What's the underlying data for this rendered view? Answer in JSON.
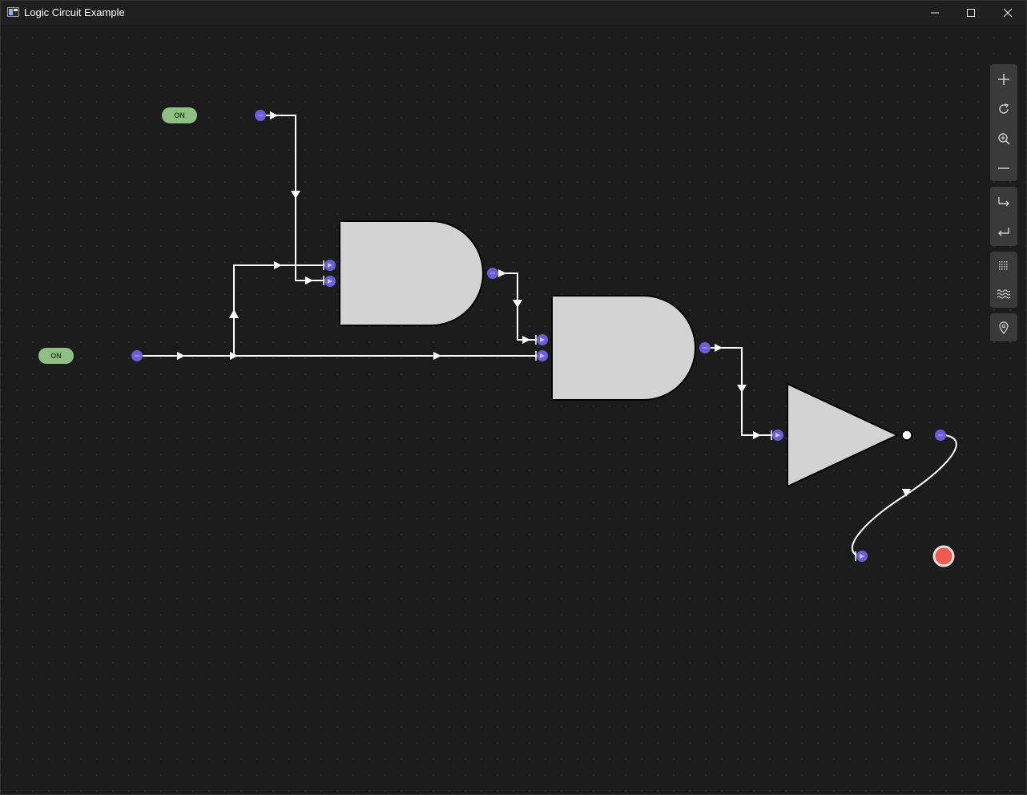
{
  "window": {
    "title": "Logic Circuit Example"
  },
  "nodes": {
    "toggle_top": {
      "label": "ON"
    },
    "toggle_left": {
      "label": "ON"
    }
  },
  "toolbar": {
    "groups": [
      [
        "plus-icon",
        "refresh-icon",
        "zoom-in-icon",
        "minus-icon"
      ],
      [
        "redirect-icon",
        "enter-icon"
      ],
      [
        "grid-icon",
        "wave-icon"
      ],
      [
        "pin-icon"
      ]
    ]
  },
  "colors": {
    "canvas": "#1c1c1c",
    "gate_fill": "#d3d3d3",
    "port": "#6a5fd6",
    "toggle": "#8fbf84",
    "output_on": "#f05a50",
    "wire": "#ffffff"
  }
}
